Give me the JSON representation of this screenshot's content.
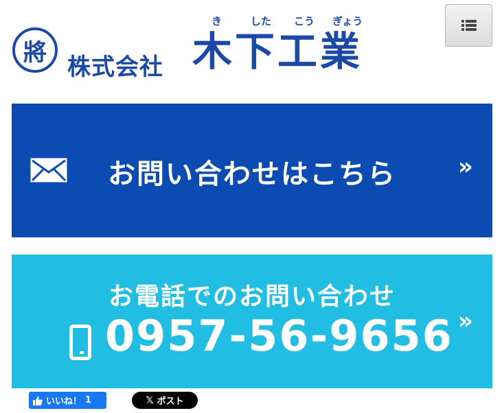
{
  "header": {
    "logo_mark": "將",
    "company_prefix": "株式会社",
    "company_name": "木下工業",
    "ruby": [
      "き",
      "した",
      "こう",
      "ぎょう"
    ]
  },
  "menu": {
    "icon": "list-icon"
  },
  "mail_banner": {
    "label": "お問い合わせはこちら",
    "arrow": "»",
    "icon": "envelope-icon",
    "bg": "#0b4bb2"
  },
  "tel_banner": {
    "title": "お電話でのお問い合わせ",
    "number": "0957-56-9656",
    "arrow": "»",
    "icon": "smartphone-icon",
    "bg": "#21bde2"
  },
  "social": {
    "fb_like_label": "いいね！",
    "fb_like_count": "1",
    "x_post_label": "ポスト",
    "x_mark": "𝕏"
  }
}
